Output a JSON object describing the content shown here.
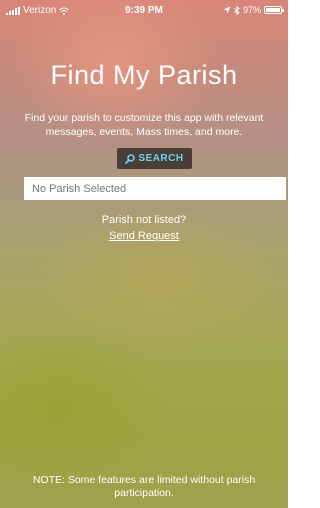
{
  "status_bar": {
    "carrier": "Verizon",
    "time": "9:39 PM",
    "battery": "97%",
    "battery_level": 0.97,
    "icons": [
      "signal-icon",
      "wifi-icon",
      "location-arrow-icon",
      "bluetooth-icon",
      "battery-icon"
    ]
  },
  "page": {
    "title": "Find My Parish",
    "subtitle": "Find your parish to customize this app with relevant messages, events, Mass times, and more."
  },
  "search": {
    "button_label": "SEARCH",
    "icon": "search-icon",
    "accent_color": "#6fd0ef"
  },
  "parish_field": {
    "placeholder": "No Parish Selected",
    "value": ""
  },
  "request": {
    "prompt": "Parish not listed?",
    "link_label": "Send Request"
  },
  "footer": {
    "note": "NOTE: Some features are limited without parish participation."
  }
}
